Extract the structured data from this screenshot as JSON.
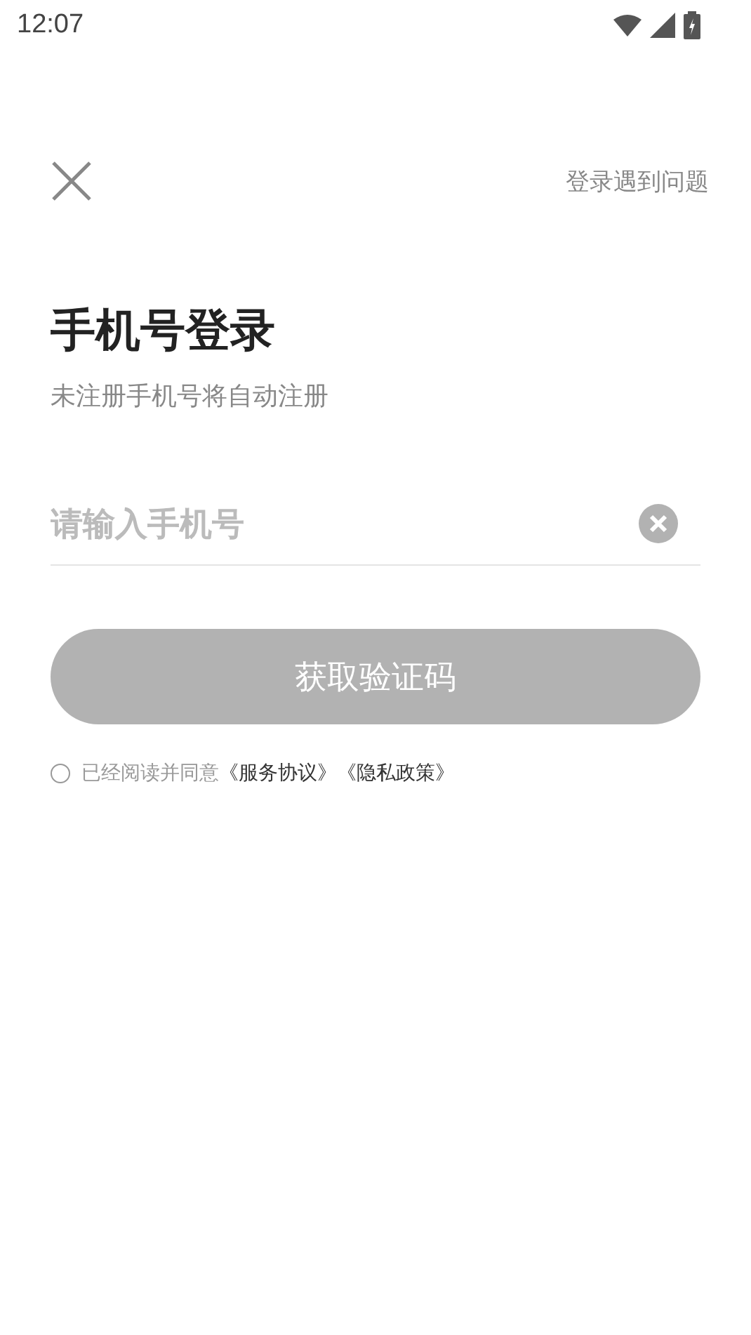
{
  "status_bar": {
    "time": "12:07"
  },
  "top_bar": {
    "help_link": "登录遇到问题"
  },
  "title": "手机号登录",
  "subtitle": "未注册手机号将自动注册",
  "phone_field": {
    "placeholder": "请输入手机号"
  },
  "submit_button": {
    "label": "获取验证码",
    "disabled": true
  },
  "agreement": {
    "checked": false,
    "text": "已经阅读并同意",
    "links": [
      "《服务协议》",
      "《隐私政策》"
    ]
  }
}
